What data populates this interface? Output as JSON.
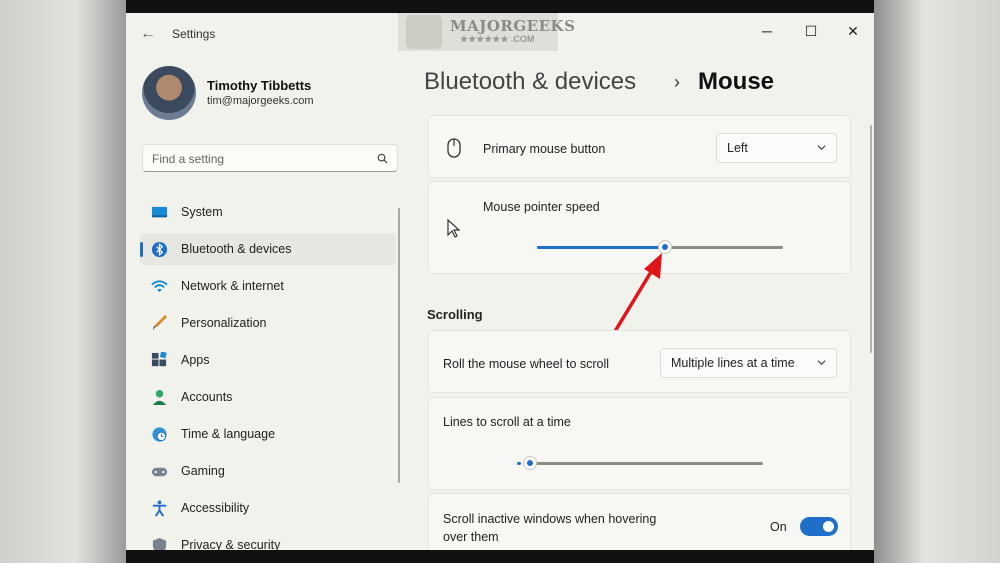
{
  "window": {
    "title": "Settings",
    "back_icon": "back-arrow-icon",
    "controls": {
      "minimize": "─",
      "maximize": "☐",
      "close": "✕"
    }
  },
  "watermark": {
    "text": "MAJORGEEKS",
    "sub": "★★★★★★ .COM"
  },
  "user": {
    "name": "Timothy Tibbetts",
    "email": "tim@majorgeeks.com"
  },
  "search": {
    "placeholder": "Find a setting"
  },
  "sidebar": {
    "items": [
      {
        "label": "System",
        "icon": "monitor-icon",
        "active": false
      },
      {
        "label": "Bluetooth & devices",
        "icon": "bluetooth-icon",
        "active": true
      },
      {
        "label": "Network & internet",
        "icon": "wifi-icon",
        "active": false
      },
      {
        "label": "Personalization",
        "icon": "brush-icon",
        "active": false
      },
      {
        "label": "Apps",
        "icon": "apps-icon",
        "active": false
      },
      {
        "label": "Accounts",
        "icon": "person-icon",
        "active": false
      },
      {
        "label": "Time & language",
        "icon": "globe-clock-icon",
        "active": false
      },
      {
        "label": "Gaming",
        "icon": "gamepad-icon",
        "active": false
      },
      {
        "label": "Accessibility",
        "icon": "accessibility-icon",
        "active": false
      },
      {
        "label": "Privacy & security",
        "icon": "shield-icon",
        "active": false
      }
    ]
  },
  "breadcrumb": {
    "parent": "Bluetooth & devices",
    "separator": "›",
    "current": "Mouse"
  },
  "main": {
    "primary_button": {
      "label": "Primary mouse button",
      "value": "Left",
      "icon": "mouse-icon"
    },
    "pointer_speed": {
      "label": "Mouse pointer speed",
      "value_fraction": 0.52,
      "icon": "pointer-icon"
    },
    "scrolling_section": "Scrolling",
    "wheel_scroll": {
      "label": "Roll the mouse wheel to scroll",
      "value": "Multiple lines at a time"
    },
    "lines_to_scroll": {
      "label": "Lines to scroll at a time",
      "value_fraction": 0.0
    },
    "inactive_scroll": {
      "label_line1": "Scroll inactive windows when hovering",
      "label_line2": "over them",
      "state": "On",
      "enabled": true
    }
  },
  "colors": {
    "accent": "#1f6fc8",
    "annotation_arrow": "#e0141b"
  }
}
